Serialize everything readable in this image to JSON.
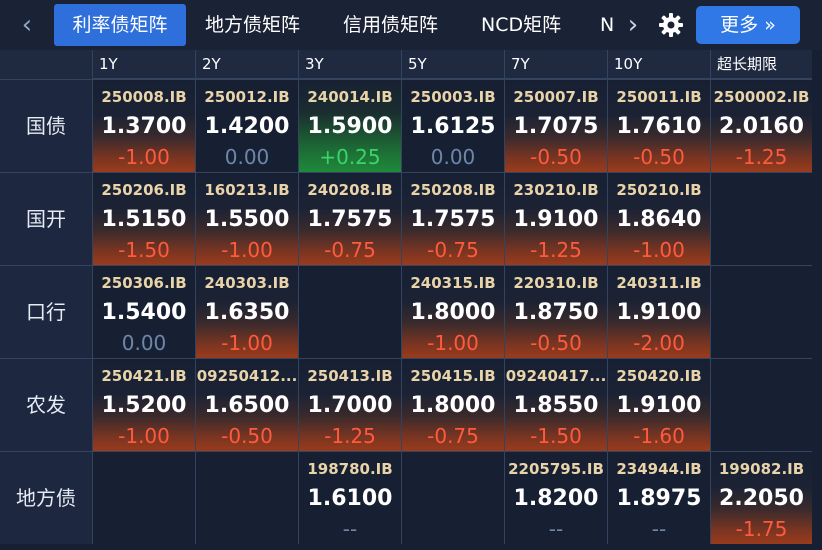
{
  "topbar": {
    "back_icon": "chevron-left-icon",
    "tabs": [
      {
        "label": "利率债矩阵",
        "active": true
      },
      {
        "label": "地方债矩阵",
        "active": false
      },
      {
        "label": "信用债矩阵",
        "active": false
      },
      {
        "label": "NCD矩阵",
        "active": false
      },
      {
        "label": "N",
        "active": false
      }
    ],
    "forward_icon": "chevron-right-icon",
    "settings_icon": "gear-icon",
    "more_label": "更多 »"
  },
  "columns": [
    "1Y",
    "2Y",
    "3Y",
    "5Y",
    "7Y",
    "10Y",
    "超长期限"
  ],
  "rows": [
    {
      "label": "国债",
      "cells": [
        {
          "code": "250008.IB",
          "rate": "1.3700",
          "change": "-1.00",
          "trend": "down"
        },
        {
          "code": "250012.IB",
          "rate": "1.4200",
          "change": "0.00",
          "trend": "flat"
        },
        {
          "code": "240014.IB",
          "rate": "1.5900",
          "change": "+0.25",
          "trend": "up"
        },
        {
          "code": "250003.IB",
          "rate": "1.6125",
          "change": "0.00",
          "trend": "flat"
        },
        {
          "code": "250007.IB",
          "rate": "1.7075",
          "change": "-0.50",
          "trend": "down"
        },
        {
          "code": "250011.IB",
          "rate": "1.7610",
          "change": "-0.50",
          "trend": "down"
        },
        {
          "code": "2500002.IB",
          "rate": "2.0160",
          "change": "-1.25",
          "trend": "down"
        }
      ]
    },
    {
      "label": "国开",
      "cells": [
        {
          "code": "250206.IB",
          "rate": "1.5150",
          "change": "-1.50",
          "trend": "down"
        },
        {
          "code": "160213.IB",
          "rate": "1.5500",
          "change": "-1.00",
          "trend": "down"
        },
        {
          "code": "240208.IB",
          "rate": "1.7575",
          "change": "-0.75",
          "trend": "down"
        },
        {
          "code": "250208.IB",
          "rate": "1.7575",
          "change": "-0.75",
          "trend": "down"
        },
        {
          "code": "230210.IB",
          "rate": "1.9100",
          "change": "-1.25",
          "trend": "down"
        },
        {
          "code": "250210.IB",
          "rate": "1.8640",
          "change": "-1.00",
          "trend": "down"
        },
        null
      ]
    },
    {
      "label": "口行",
      "cells": [
        {
          "code": "250306.IB",
          "rate": "1.5400",
          "change": "0.00",
          "trend": "flat"
        },
        {
          "code": "240303.IB",
          "rate": "1.6350",
          "change": "-1.00",
          "trend": "down"
        },
        null,
        {
          "code": "240315.IB",
          "rate": "1.8000",
          "change": "-1.00",
          "trend": "down"
        },
        {
          "code": "220310.IB",
          "rate": "1.8750",
          "change": "-0.50",
          "trend": "down"
        },
        {
          "code": "240311.IB",
          "rate": "1.9100",
          "change": "-2.00",
          "trend": "down"
        },
        null
      ]
    },
    {
      "label": "农发",
      "cells": [
        {
          "code": "250421.IB",
          "rate": "1.5200",
          "change": "-1.00",
          "trend": "down"
        },
        {
          "code": "09250412...",
          "rate": "1.6500",
          "change": "-0.50",
          "trend": "down"
        },
        {
          "code": "250413.IB",
          "rate": "1.7000",
          "change": "-1.25",
          "trend": "down"
        },
        {
          "code": "250415.IB",
          "rate": "1.8000",
          "change": "-0.75",
          "trend": "down"
        },
        {
          "code": "09240417...",
          "rate": "1.8550",
          "change": "-1.50",
          "trend": "down"
        },
        {
          "code": "250420.IB",
          "rate": "1.9100",
          "change": "-1.60",
          "trend": "down"
        },
        null
      ]
    },
    {
      "label": "地方债",
      "cells": [
        null,
        null,
        {
          "code": "198780.IB",
          "rate": "1.6100",
          "change": "--",
          "trend": "na"
        },
        null,
        {
          "code": "2205795.IB",
          "rate": "1.8200",
          "change": "--",
          "trend": "na"
        },
        {
          "code": "234944.IB",
          "rate": "1.8975",
          "change": "--",
          "trend": "na"
        },
        {
          "code": "199082.IB",
          "rate": "2.2050",
          "change": "-1.75",
          "trend": "down"
        }
      ]
    }
  ],
  "colors": {
    "accent": "#2f6fdc",
    "negative": "#ff5a3c",
    "positive": "#3bd46a",
    "neutral": "#6f86aa",
    "code_text": "#e9d3a8"
  }
}
